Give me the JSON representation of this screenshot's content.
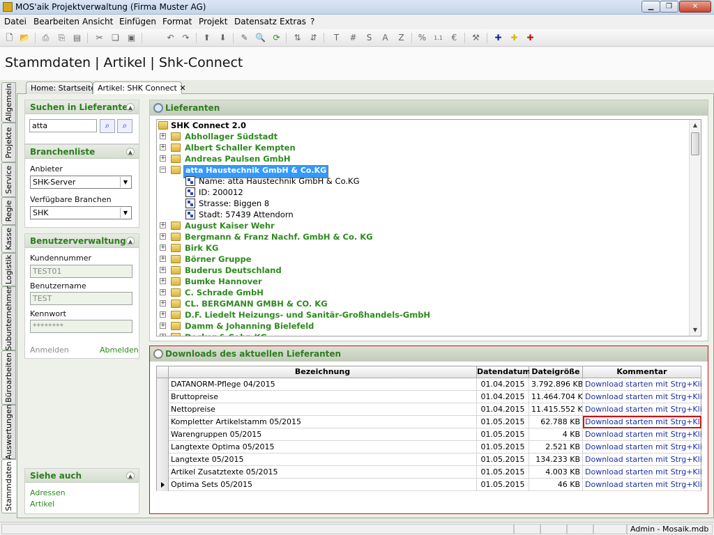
{
  "window": {
    "title": "MOS'aik Projektverwaltung (Firma Muster AG)"
  },
  "menu": [
    "Datei",
    "Bearbeiten",
    "Ansicht",
    "Einfügen",
    "Format",
    "Projekt",
    "Datensatz",
    "Extras",
    "?"
  ],
  "page": {
    "heading": "Stammdaten | Artikel | Shk-Connect"
  },
  "vertical_tabs": [
    "Allgemein",
    "Projekte",
    "Service",
    "Regie",
    "Kasse",
    "Logistik",
    "Subunternehmer",
    "Büroarbeiten",
    "Auswertungen",
    "Stammdaten"
  ],
  "doc_tabs": [
    "Home: Startseite",
    "Artikel: SHK Connect"
  ],
  "search_panel": {
    "title": "Suchen in Lieferanten",
    "value": "atta"
  },
  "branchen_panel": {
    "title": "Branchenliste",
    "anbieter_label": "Anbieter",
    "anbieter_value": "SHK-Server",
    "branchen_label": "Verfügbare Branchen",
    "branchen_value": "SHK"
  },
  "user_panel": {
    "title": "Benutzerverwaltung",
    "kunden_label": "Kundennummer",
    "kunden_value": "TEST01",
    "benutzer_label": "Benutzername",
    "benutzer_value": "TEST",
    "kennwort_label": "Kennwort",
    "kennwort_value": "********",
    "anmelden": "Anmelden",
    "abmelden": "Abmelden"
  },
  "see_also": {
    "title": "Siehe auch",
    "links": [
      "Adressen",
      "Artikel"
    ]
  },
  "lieferanten": {
    "title": "Lieferanten",
    "root": "SHK Connect 2.0",
    "items_before": [
      "Abhollager Südstadt",
      "Albert Schaller Kempten",
      "Andreas Paulsen GmbH"
    ],
    "selected": "atta Haustechnik GmbH & Co.KG",
    "details": [
      "Name: atta Haustechnik GmbH & Co.KG",
      "ID: 200012",
      "Strasse: Biggen 8",
      "Stadt: 57439 Attendorn"
    ],
    "items_after": [
      "August Kaiser Wehr",
      "Bergmann & Franz Nachf. GmbH & Co. KG",
      "Birk KG",
      "Börner Gruppe",
      "Buderus Deutschland",
      "Bumke Hannover",
      "C. Schrade GmbH",
      "CL. BERGMANN GMBH & CO. KG",
      "D.F. Liedelt Heizungs- und Sanitär-Großhandels-GmbH",
      "Damm & Johanning Bielefeld",
      "Decker & Sohn KG"
    ]
  },
  "downloads": {
    "title": "Downloads des aktuellen Lieferanten",
    "columns": [
      "Bezeichnung",
      "Datendatum",
      "Dateigröße",
      "Kommentar"
    ],
    "rows": [
      [
        "DATANORM-Pflege 04/2015",
        "01.04.2015",
        "3.792.896 KB",
        "Download starten mit Strg+Klick..."
      ],
      [
        "Bruttopreise",
        "01.04.2015",
        "11.464.704 KB",
        "Download starten mit Strg+Klick..."
      ],
      [
        "Nettopreise",
        "01.04.2015",
        "11.415.552 KB",
        "Download starten mit Strg+Klick..."
      ],
      [
        "Kompletter Artikelstamm 05/2015",
        "01.05.2015",
        "62.788 KB",
        "Download starten mit Strg+Klick..."
      ],
      [
        "Warengruppen 05/2015",
        "01.05.2015",
        "4 KB",
        "Download starten mit Strg+Klick..."
      ],
      [
        "Langtexte Optima 05/2015",
        "01.05.2015",
        "2.521 KB",
        "Download starten mit Strg+Klick..."
      ],
      [
        "Langtexte 05/2015",
        "01.05.2015",
        "134.233 KB",
        "Download starten mit Strg+Klick..."
      ],
      [
        "Artikel Zusatztexte 05/2015",
        "01.05.2015",
        "4.003 KB",
        "Download starten mit Strg+Klick..."
      ],
      [
        "Optima Sets 05/2015",
        "01.05.2015",
        "46 KB",
        "Download starten mit Strg+Klick..."
      ]
    ]
  },
  "status": {
    "user": "Admin - Mosaik.mdb"
  }
}
